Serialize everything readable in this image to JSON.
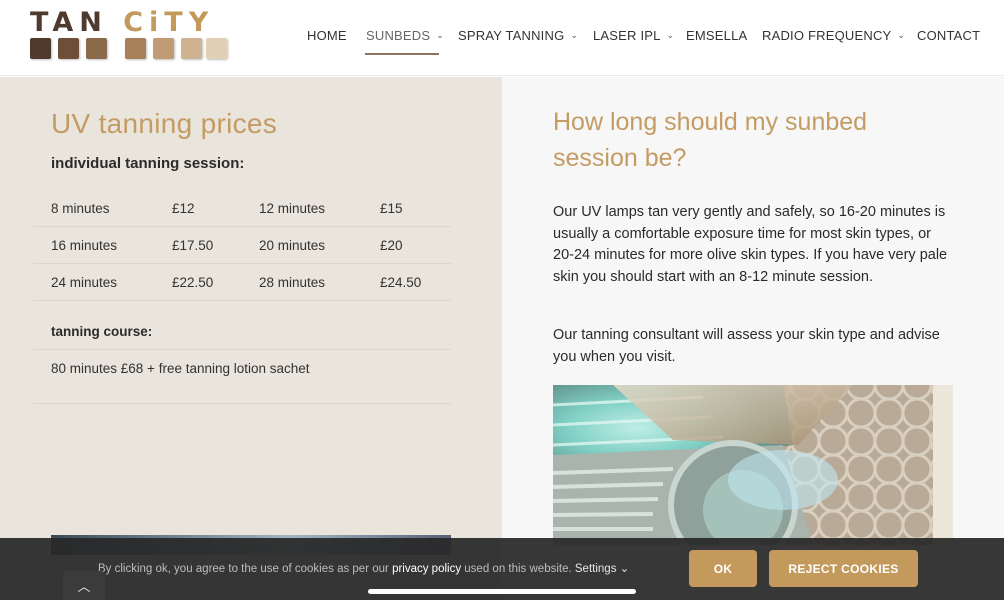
{
  "logo": {
    "part1": "TAN ",
    "part2": "CiTY",
    "swatch_colors_dark": [
      "#4f3a2c",
      "#6d4f39",
      "#8b6a4c"
    ],
    "swatch_colors_light": [
      "#a88059",
      "#bf9c74",
      "#cfb494",
      "#e1d0b6"
    ]
  },
  "nav": {
    "items": [
      {
        "label": "HOME",
        "dropdown": false
      },
      {
        "label": "SUNBEDS",
        "dropdown": true,
        "active": true
      },
      {
        "label": "SPRAY TANNING",
        "dropdown": true
      },
      {
        "label": "LASER IPL",
        "dropdown": true
      },
      {
        "label": "EMSELLA",
        "dropdown": false
      },
      {
        "label": "RADIO FREQUENCY",
        "dropdown": true
      },
      {
        "label": "CONTACT",
        "dropdown": false
      }
    ],
    "chevron": "⌄"
  },
  "left": {
    "heading": "UV tanning prices",
    "session_label": "individual tanning session:",
    "rows": [
      [
        "8 minutes",
        "£12",
        "12 minutes",
        "£15"
      ],
      [
        "16 minutes",
        "£17.50",
        "20 minutes",
        "£20"
      ],
      [
        "24 minutes",
        "£22.50",
        "28 minutes",
        "£24.50"
      ]
    ],
    "course_label": "tanning course:",
    "course_text": "80 minutes  £68  +  free tanning lotion sachet"
  },
  "right": {
    "heading": "How long should my sunbed session be?",
    "para1": "Our UV lamps tan very gently and safely, so 16-20 minutes is usually a comfortable exposure time for most skin types, or 20-24 minutes for more olive skin types. If you have very pale skin you should start with an 8-12 minute session.",
    "para2": "Our tanning consultant will assess your skin type and advise you when you visit."
  },
  "cookie": {
    "text_before": "By clicking ok, you agree to the use of cookies as per our ",
    "link": "privacy policy",
    "text_after": " used on this website. ",
    "settings": "Settings",
    "settings_chevron": "⌄",
    "ok": "OK",
    "reject": "REJECT COOKIES",
    "to_top_icon": "︿"
  },
  "colors": {
    "accent": "#c39a5c",
    "left_bg": "#e9e4dc",
    "right_bg": "#f7f7f7",
    "cookie_bg": "#2a2a2a"
  }
}
